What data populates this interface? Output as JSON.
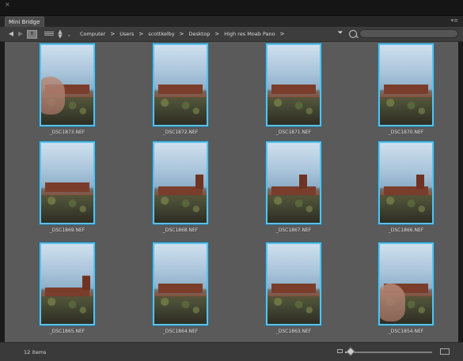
{
  "window": {
    "close_glyph": "×",
    "panel_tab": "Mini Bridge",
    "panel_menu_glyph": "▾≡"
  },
  "navigation": {
    "back_glyph": "◀",
    "forward_glyph": "▶",
    "breadcrumbs": [
      "Computer",
      "Users",
      "scottkelby",
      "Desktop",
      "High res Moab Pano"
    ],
    "separator": ">"
  },
  "search": {
    "placeholder": "",
    "value": ""
  },
  "icons": {
    "back": "back-arrow-icon",
    "forward": "forward-arrow-icon",
    "view_mode": "view-mode-icon",
    "list_view": "list-view-icon",
    "sort": "sort-updown-icon",
    "path": "path-separator-icon",
    "filter": "filter-icon",
    "search": "search-icon",
    "zoom_small": "thumbnail-small-icon",
    "zoom_large": "thumbnail-large-icon"
  },
  "thumbnails": [
    {
      "filename": "_DSC1873.NEF",
      "variant": "hand-left"
    },
    {
      "filename": "_DSC1872.NEF",
      "variant": "mesa"
    },
    {
      "filename": "_DSC1871.NEF",
      "variant": "mesa"
    },
    {
      "filename": "_DSC1870.NEF",
      "variant": "mesa"
    },
    {
      "filename": "_DSC1869.NEF",
      "variant": "mesa"
    },
    {
      "filename": "_DSC1868.NEF",
      "variant": "butte"
    },
    {
      "filename": "_DSC1867.NEF",
      "variant": "butte"
    },
    {
      "filename": "_DSC1866.NEF",
      "variant": "butte"
    },
    {
      "filename": "_DSC1865.NEF",
      "variant": "butte"
    },
    {
      "filename": "_DSC1864.NEF",
      "variant": "mesa"
    },
    {
      "filename": "_DSC1863.NEF",
      "variant": "mesa"
    },
    {
      "filename": "_DSC1854.NEF",
      "variant": "hand-low"
    }
  ],
  "status": {
    "item_count": "12 items",
    "thumbnail_size_fraction": 0.05
  },
  "colors": {
    "selection_border": "#5cc0e8",
    "content_bg": "#5a5a5a"
  }
}
